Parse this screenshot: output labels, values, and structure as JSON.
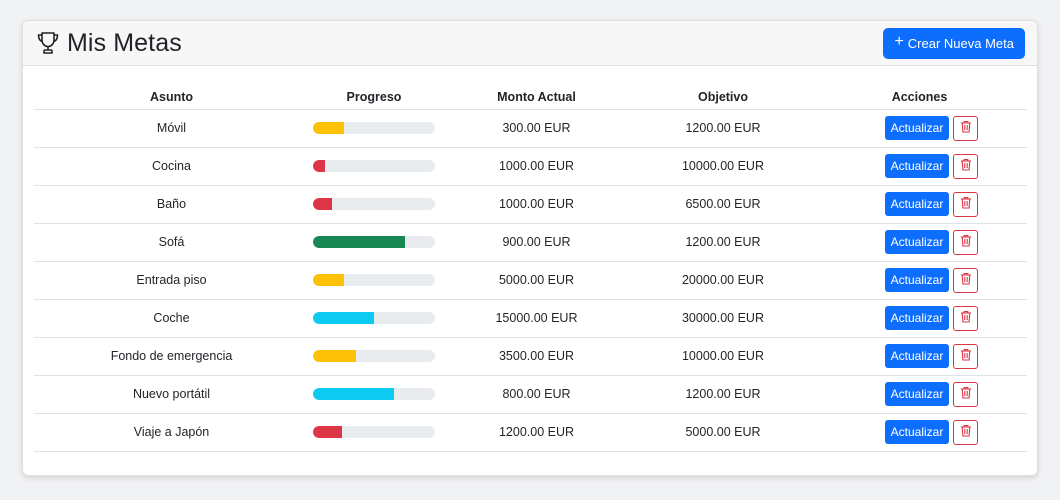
{
  "header": {
    "title": "Mis Metas",
    "icon": "trophy-icon",
    "new_goal_label": "Crear Nueva Meta"
  },
  "table": {
    "columns": [
      "Asunto",
      "Progreso",
      "Monto Actual",
      "Objetivo",
      "Acciones"
    ],
    "update_label": "Actualizar",
    "rows": [
      {
        "asunto": "Móvil",
        "actual": "300.00 EUR",
        "objetivo": "1200.00 EUR",
        "progress": 0.25,
        "color": "#ffc107"
      },
      {
        "asunto": "Cocina",
        "actual": "1000.00 EUR",
        "objetivo": "10000.00 EUR",
        "progress": 0.1,
        "color": "#dc3545"
      },
      {
        "asunto": "Baño",
        "actual": "1000.00 EUR",
        "objetivo": "6500.00 EUR",
        "progress": 0.154,
        "color": "#dc3545"
      },
      {
        "asunto": "Sofá",
        "actual": "900.00 EUR",
        "objetivo": "1200.00 EUR",
        "progress": 0.75,
        "color": "#198754"
      },
      {
        "asunto": "Entrada piso",
        "actual": "5000.00 EUR",
        "objetivo": "20000.00 EUR",
        "progress": 0.25,
        "color": "#ffc107"
      },
      {
        "asunto": "Coche",
        "actual": "15000.00 EUR",
        "objetivo": "30000.00 EUR",
        "progress": 0.5,
        "color": "#0dcaf0"
      },
      {
        "asunto": "Fondo de emergencia",
        "actual": "3500.00 EUR",
        "objetivo": "10000.00 EUR",
        "progress": 0.35,
        "color": "#ffc107"
      },
      {
        "asunto": "Nuevo portátil",
        "actual": "800.00 EUR",
        "objetivo": "1200.00 EUR",
        "progress": 0.667,
        "color": "#0dcaf0"
      },
      {
        "asunto": "Viaje a Japón",
        "actual": "1200.00 EUR",
        "objetivo": "5000.00 EUR",
        "progress": 0.24,
        "color": "#dc3545"
      }
    ]
  }
}
